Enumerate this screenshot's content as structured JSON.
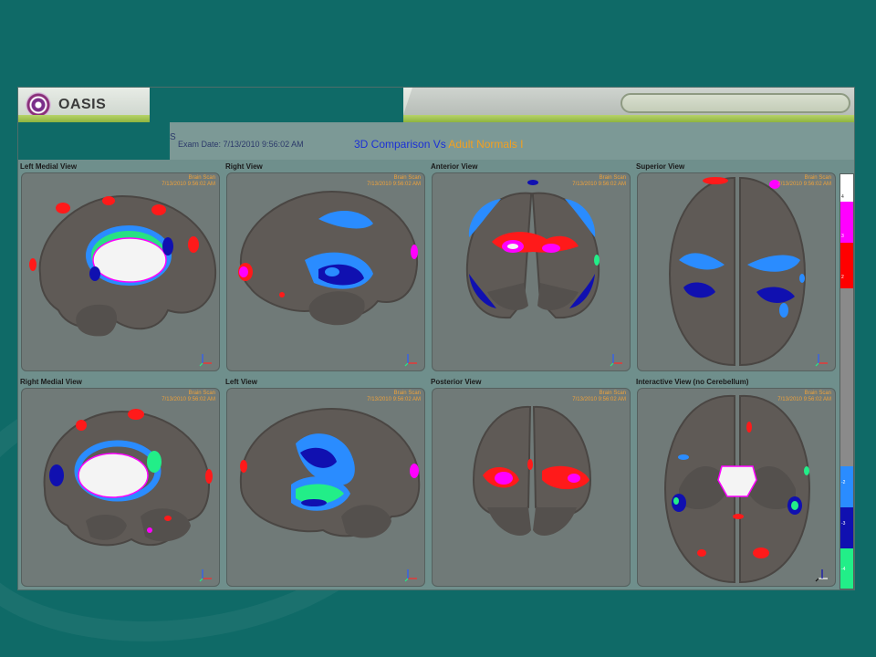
{
  "app": {
    "logo_text": "OASIS"
  },
  "header": {
    "partial_label": "S",
    "exam_date": "Exam Date: 7/13/2010 9:56:02 AM",
    "comparison_prefix": "3D Comparison Vs ",
    "comparison_reference": "Adult Normals I"
  },
  "panels": [
    {
      "label": "Left Medial View",
      "vp_title": "Brain Scan",
      "vp_time": "7/13/2010 9:56:02 AM"
    },
    {
      "label": "Right View",
      "vp_title": "Brain Scan",
      "vp_time": "7/13/2010 9:56:02 AM"
    },
    {
      "label": "Anterior View",
      "vp_title": "Brain Scan",
      "vp_time": "7/13/2010 9:56:02 AM"
    },
    {
      "label": "Superior View",
      "vp_title": "Brain Scan",
      "vp_time": "7/13/2010 9:56:02 AM"
    },
    {
      "label": "Right Medial View",
      "vp_title": "Brain Scan",
      "vp_time": "7/13/2010 9:56:02 AM"
    },
    {
      "label": "Left View",
      "vp_title": "Brain Scan",
      "vp_time": "7/13/2010 9:56:02 AM"
    },
    {
      "label": "Posterior View",
      "vp_title": "Brain Scan",
      "vp_time": "7/13/2010 9:56:02 AM"
    },
    {
      "label": "Interactive View (no Cerebellum)",
      "vp_title": "Brain Scan",
      "vp_time": "7/13/2010 9:56:02 AM"
    }
  ],
  "colorbar": {
    "ticks": [
      "4",
      "3",
      "2",
      "-2",
      "-3",
      "-4"
    ],
    "colors": {
      "top": "#ffffff",
      "pos3": "#ff00ff",
      "pos2": "#ff0000",
      "neutral": "#8a8a8a",
      "neg2": "#2a8cff",
      "neg3": "#1010b0",
      "neg4": "#22ee88"
    }
  },
  "colors": {
    "background": "#0f6a67",
    "brain": "#5f5a56",
    "comparison_title": "#1a2fd6",
    "reference_accent": "#f3a01f"
  }
}
